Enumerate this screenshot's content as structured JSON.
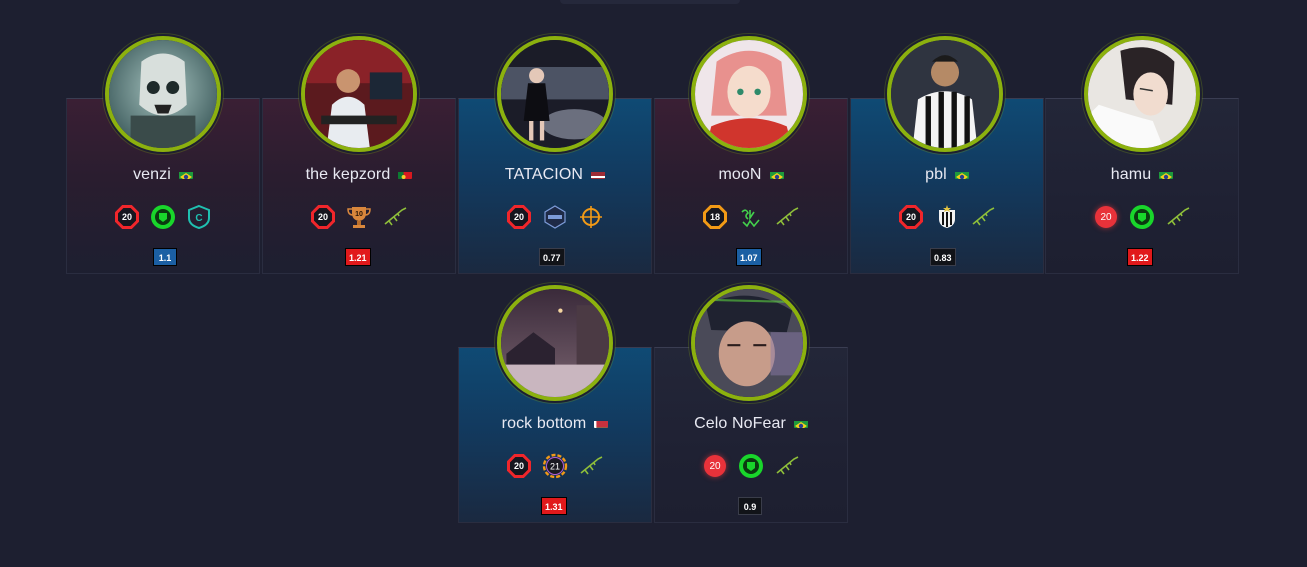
{
  "players": [
    {
      "name": "venzi",
      "flag": "brazil",
      "level": "20",
      "kd": "1.1",
      "card": "red",
      "badges": [
        "faceit-elo-icon",
        "green-mask-icon",
        "c-shield-icon"
      ]
    },
    {
      "name": "the kepzord",
      "flag": "portugal",
      "level": "20",
      "kd": "1.21",
      "card": "red",
      "badges": [
        "faceit-elo-icon",
        "trophy-10-icon",
        "rifle-icon"
      ]
    },
    {
      "name": "TATACION",
      "flag": "latvia",
      "level": "20",
      "kd": "0.77",
      "card": "blue",
      "badges": [
        "faceit-elo-icon",
        "hex-emblem-icon",
        "crosshair-icon"
      ]
    },
    {
      "name": "mooN",
      "flag": "brazil",
      "level": "18",
      "kd": "1.07",
      "card": "red",
      "badges": [
        "faceit-elo-orange-icon",
        "graffiti-icon",
        "rifle-icon"
      ]
    },
    {
      "name": "pbl",
      "flag": "brazil",
      "level": "20",
      "kd": "0.83",
      "card": "blue",
      "badges": [
        "faceit-elo-icon",
        "club-crest-icon",
        "rifle-icon"
      ]
    },
    {
      "name": "hamu",
      "flag": "brazil",
      "level": "20",
      "kd": "1.22",
      "card": "dark",
      "badges": [
        "circle-level-icon",
        "green-mask-icon",
        "rifle-icon"
      ]
    },
    {
      "name": "rock bottom",
      "flag": "belarus",
      "level": "20",
      "kd": "1.31",
      "card": "blue",
      "badges": [
        "faceit-elo-icon",
        "rainbow-21-icon",
        "rifle-icon"
      ]
    },
    {
      "name": "Celo NoFear",
      "flag": "brazil",
      "level": "20",
      "kd": "0.9",
      "card": "dark",
      "badges": [
        "circle-level-icon",
        "green-mask-icon",
        "rifle-icon"
      ]
    }
  ],
  "trophy_number": "10",
  "rainbow_number": "21",
  "colors": {
    "avatar_ring": "#8cb10e",
    "level_red": "#f0262b",
    "level_orange": "#f29a16",
    "kd_blue": "#1b5fa3",
    "kd_red": "#e1191b",
    "background": "#1d1f30"
  }
}
